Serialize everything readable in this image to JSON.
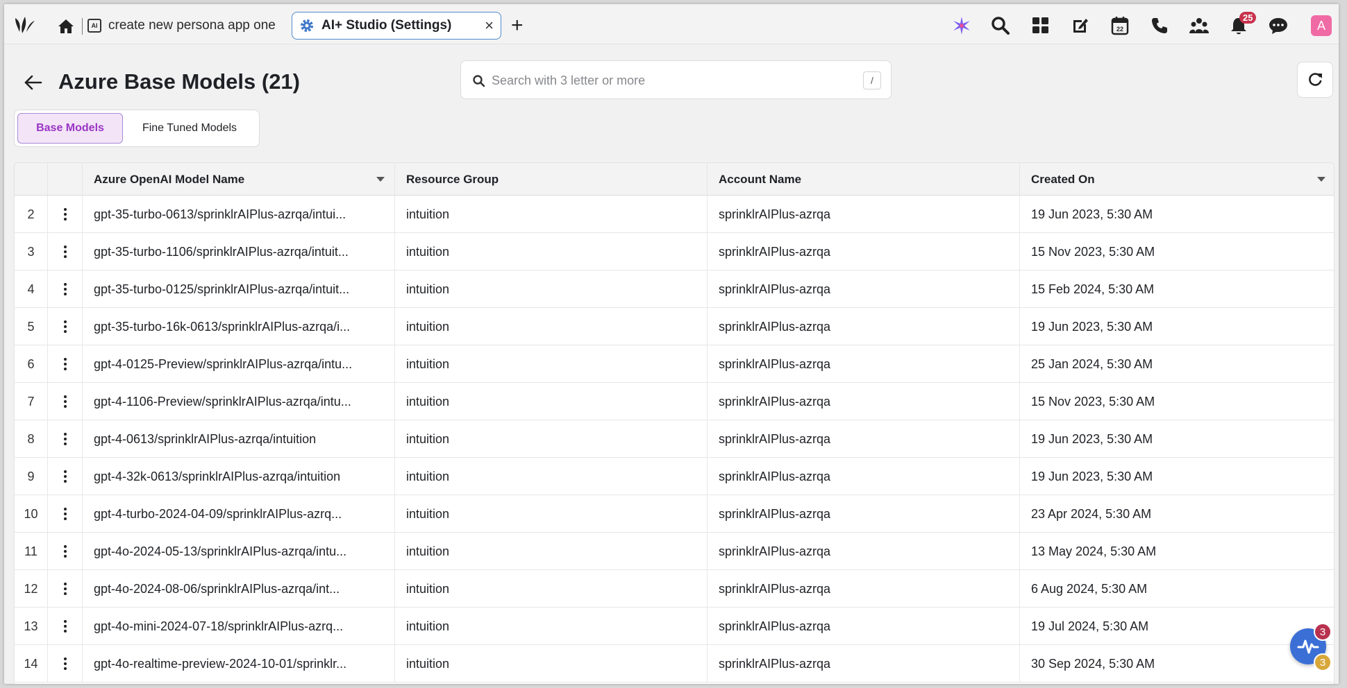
{
  "topbar": {
    "tabs": [
      {
        "label": "create new persona app one",
        "icon": "app-icon"
      },
      {
        "label": "AI+ Studio (Settings)",
        "icon": "gear-icon",
        "close": "×"
      }
    ],
    "new_tab": "+",
    "notification_count": "25",
    "avatar_initial": "A"
  },
  "header": {
    "title": "Azure Base Models (21)",
    "search_placeholder": "Search with 3 letter or more",
    "search_shortcut": "/"
  },
  "toggle": {
    "base": "Base Models",
    "fine_tuned": "Fine Tuned Models"
  },
  "table": {
    "columns": [
      "Azure OpenAI Model Name",
      "Resource Group",
      "Account Name",
      "Created On"
    ],
    "rows": [
      {
        "n": "2",
        "model": "gpt-35-turbo-0613/sprinklrAIPlus-azrqa/intui...",
        "group": "intuition",
        "account": "sprinklrAIPlus-azrqa",
        "created": "19 Jun 2023, 5:30 AM"
      },
      {
        "n": "3",
        "model": "gpt-35-turbo-1106/sprinklrAIPlus-azrqa/intuit...",
        "group": "intuition",
        "account": "sprinklrAIPlus-azrqa",
        "created": "15 Nov 2023, 5:30 AM"
      },
      {
        "n": "4",
        "model": "gpt-35-turbo-0125/sprinklrAIPlus-azrqa/intuit...",
        "group": "intuition",
        "account": "sprinklrAIPlus-azrqa",
        "created": "15 Feb 2024, 5:30 AM"
      },
      {
        "n": "5",
        "model": "gpt-35-turbo-16k-0613/sprinklrAIPlus-azrqa/i...",
        "group": "intuition",
        "account": "sprinklrAIPlus-azrqa",
        "created": "19 Jun 2023, 5:30 AM"
      },
      {
        "n": "6",
        "model": "gpt-4-0125-Preview/sprinklrAIPlus-azrqa/intu...",
        "group": "intuition",
        "account": "sprinklrAIPlus-azrqa",
        "created": "25 Jan 2024, 5:30 AM"
      },
      {
        "n": "7",
        "model": "gpt-4-1106-Preview/sprinklrAIPlus-azrqa/intu...",
        "group": "intuition",
        "account": "sprinklrAIPlus-azrqa",
        "created": "15 Nov 2023, 5:30 AM"
      },
      {
        "n": "8",
        "model": "gpt-4-0613/sprinklrAIPlus-azrqa/intuition",
        "group": "intuition",
        "account": "sprinklrAIPlus-azrqa",
        "created": "19 Jun 2023, 5:30 AM"
      },
      {
        "n": "9",
        "model": "gpt-4-32k-0613/sprinklrAIPlus-azrqa/intuition",
        "group": "intuition",
        "account": "sprinklrAIPlus-azrqa",
        "created": "19 Jun 2023, 5:30 AM"
      },
      {
        "n": "10",
        "model": "gpt-4-turbo-2024-04-09/sprinklrAIPlus-azrq...",
        "group": "intuition",
        "account": "sprinklrAIPlus-azrqa",
        "created": "23 Apr 2024, 5:30 AM"
      },
      {
        "n": "11",
        "model": "gpt-4o-2024-05-13/sprinklrAIPlus-azrqa/intu...",
        "group": "intuition",
        "account": "sprinklrAIPlus-azrqa",
        "created": "13 May 2024, 5:30 AM"
      },
      {
        "n": "12",
        "model": "gpt-4o-2024-08-06/sprinklrAIPlus-azrqa/int...",
        "group": "intuition",
        "account": "sprinklrAIPlus-azrqa",
        "created": "6 Aug 2024, 5:30 AM"
      },
      {
        "n": "13",
        "model": "gpt-4o-mini-2024-07-18/sprinklrAIPlus-azrq...",
        "group": "intuition",
        "account": "sprinklrAIPlus-azrqa",
        "created": "19 Jul 2024, 5:30 AM"
      },
      {
        "n": "14",
        "model": "gpt-4o-realtime-preview-2024-10-01/sprinklr...",
        "group": "intuition",
        "account": "sprinklrAIPlus-azrqa",
        "created": "30 Sep 2024, 5:30 AM"
      }
    ]
  },
  "widget": {
    "badge_top": "3",
    "badge_bottom": "3"
  },
  "colors": {
    "accent": "#9a35c4",
    "tab_border": "#4f8ac9",
    "badge": "#c8324c",
    "fab": "#3b6fd6"
  }
}
